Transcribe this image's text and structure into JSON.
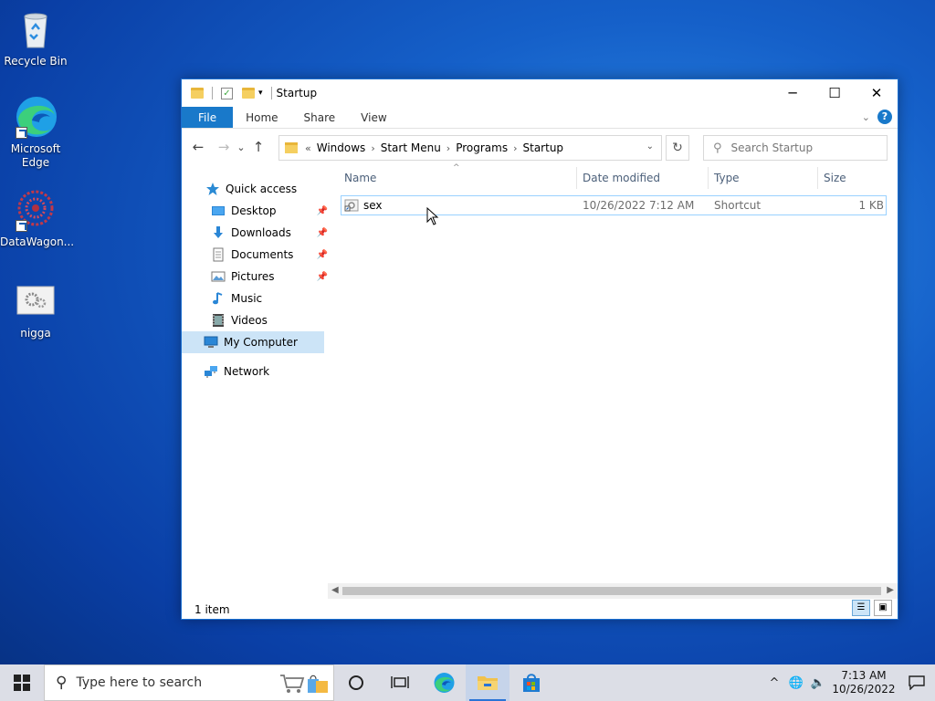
{
  "desktop": {
    "icons": [
      {
        "label": "Recycle Bin",
        "icon": "recycle-bin-icon"
      },
      {
        "label": "Microsoft Edge",
        "icon": "edge-icon"
      },
      {
        "label": "DataWagon...",
        "icon": "datawagon-icon"
      },
      {
        "label": "nigga",
        "icon": "settings-file-icon"
      }
    ]
  },
  "window": {
    "title": "Startup",
    "controls": {
      "minimize": "─",
      "maximize": "☐",
      "close": "✕"
    },
    "ribbon": {
      "tabs": [
        "File",
        "Home",
        "Share",
        "View"
      ]
    },
    "nav": {
      "back": "←",
      "forward": "→",
      "recent": "⌄",
      "up": "↑"
    },
    "address": {
      "prefix": "«",
      "crumbs": [
        "Windows",
        "Start Menu",
        "Programs",
        "Startup"
      ],
      "separator": "›"
    },
    "search_placeholder": "Search Startup",
    "navpane": {
      "quick_access": "Quick access",
      "items": [
        {
          "label": "Desktop",
          "icon": "desktop-icon",
          "pinned": true
        },
        {
          "label": "Downloads",
          "icon": "downloads-icon",
          "pinned": true
        },
        {
          "label": "Documents",
          "icon": "documents-icon",
          "pinned": true
        },
        {
          "label": "Pictures",
          "icon": "pictures-icon",
          "pinned": true
        },
        {
          "label": "Music",
          "icon": "music-icon",
          "pinned": false
        },
        {
          "label": "Videos",
          "icon": "videos-icon",
          "pinned": false
        }
      ],
      "my_computer": "My Computer",
      "network": "Network"
    },
    "columns": {
      "name": "Name",
      "date": "Date modified",
      "type": "Type",
      "size": "Size"
    },
    "files": [
      {
        "name": "sex",
        "date": "10/26/2022 7:12 AM",
        "type": "Shortcut",
        "size": "1 KB"
      }
    ],
    "status": "1 item"
  },
  "taskbar": {
    "search_placeholder": "Type here to search",
    "clock_time": "7:13 AM",
    "clock_date": "10/26/2022"
  },
  "colors": {
    "accent": "#1979ca",
    "selection": "#cce4f7",
    "taskbar": "#dcdee6"
  }
}
